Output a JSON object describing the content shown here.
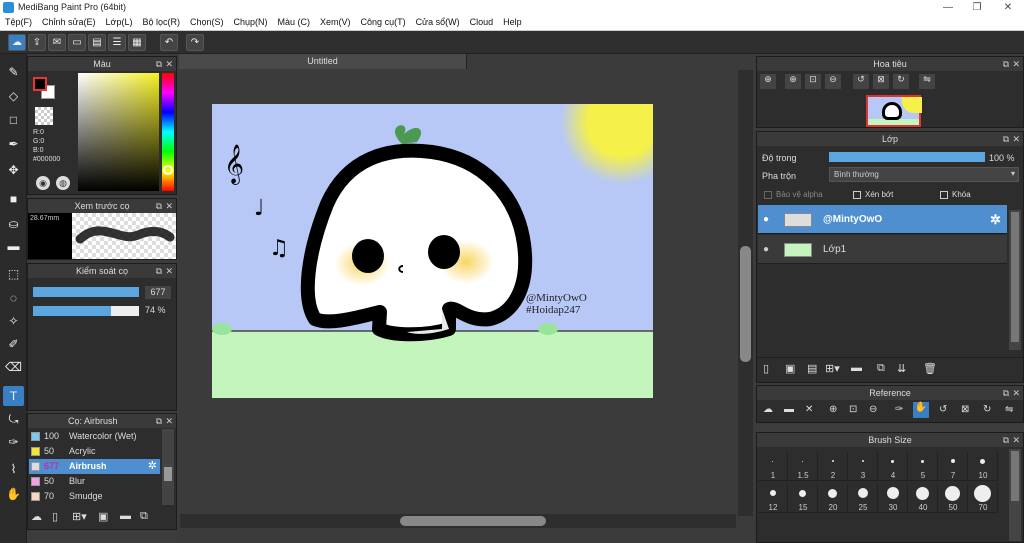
{
  "window": {
    "title": "MediBang Paint Pro (64bit)",
    "minimize": "—",
    "restore": "❐",
    "close": "✕"
  },
  "menu": [
    "Tệp(F)",
    "Chỉnh sửa(E)",
    "Lớp(L)",
    "Bộ lọc(R)",
    "Chọn(S)",
    "Chụp(N)",
    "Màu (C)",
    "Xem(V)",
    "Công cụ(T)",
    "Cửa sổ(W)",
    "Cloud",
    "Help"
  ],
  "document": {
    "tab_title": "Untitled"
  },
  "color_panel": {
    "title": "Màu",
    "r": "R:0",
    "g": "G:0",
    "b": "B:0",
    "hex": "#000000"
  },
  "brush_preview": {
    "title": "Xem trước cọ",
    "size": "28.67mm"
  },
  "brush_control": {
    "title": "Kiểm soát cọ",
    "size_value": "677",
    "opacity_value": "74 %",
    "opacity": 0.74,
    "size_fill": 1.0
  },
  "brush_list": {
    "title": "Cọ: Airbrush",
    "items": [
      {
        "size": "100",
        "name": "Watercolor (Wet)",
        "color": "#7ec8f0"
      },
      {
        "size": "50",
        "name": "Acrylic",
        "color": "#f5e62a"
      },
      {
        "size": "677",
        "name": "Airbrush",
        "color": "#dddddd"
      },
      {
        "size": "50",
        "name": "Blur",
        "color": "#f5a0e6"
      },
      {
        "size": "70",
        "name": "Smudge",
        "color": "#f7d7c0"
      }
    ]
  },
  "navigator": {
    "title": "Hoa tiêu"
  },
  "layer_panel": {
    "title": "Lớp",
    "opacity_label": "Độ trong",
    "opacity_value": "100 %",
    "opacity": 1.0,
    "blend_label": "Pha trộn",
    "blend_value": "Bình thường",
    "protect_alpha": "Bảo vệ alpha",
    "clipping": "Xén bớt",
    "lock": "Khóa",
    "layers": [
      {
        "name": "@MintyOwO"
      },
      {
        "name": "Lớp1"
      }
    ]
  },
  "reference": {
    "title": "Reference"
  },
  "brush_size": {
    "title": "Brush Size",
    "row1": [
      "1",
      "1.5",
      "2",
      "3",
      "4",
      "5",
      "7",
      "10"
    ],
    "row2": [
      "12",
      "15",
      "20",
      "25",
      "30",
      "40",
      "50",
      "70"
    ]
  },
  "artwork": {
    "watermark_line1": "@MintyOwO",
    "watermark_line2": "#Hoidap247",
    "notes": [
      "𝄞",
      "♩",
      "♫"
    ],
    "colors": {
      "sky": "#b7c8f7",
      "grass": "#c4f5bc",
      "sun": "#f5f04a",
      "outline": "#000000",
      "blush": "#f7d35a",
      "leaf": "#4c9a52"
    }
  },
  "colors": {
    "accent": "#3a7fc4",
    "panel_bg": "#2d2d2d",
    "header_bg": "#3a3a3a"
  }
}
